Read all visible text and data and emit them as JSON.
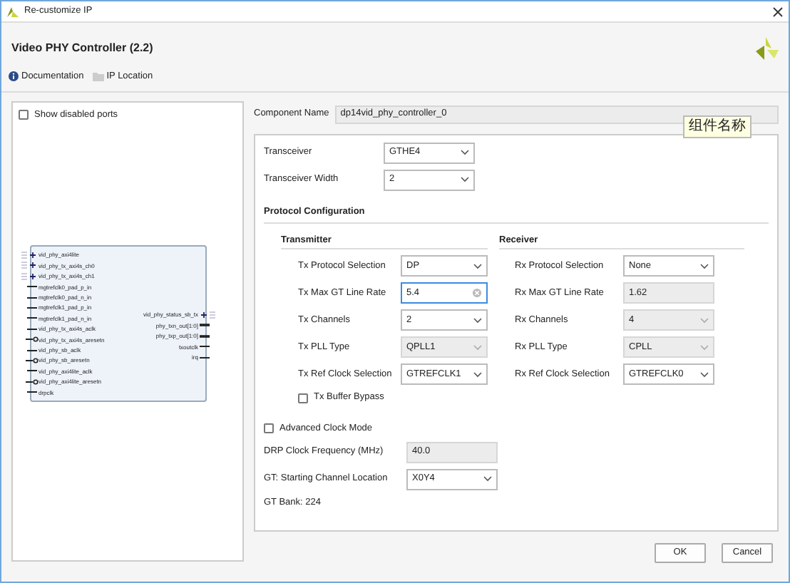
{
  "window": {
    "title": "Re-customize IP"
  },
  "header": {
    "title": "Video PHY Controller (2.2)"
  },
  "links": [
    {
      "label": "Documentation",
      "kind": "info"
    },
    {
      "label": "IP Location",
      "kind": "folder"
    }
  ],
  "show_disabled_ports": {
    "label": "Show disabled ports",
    "checked": false
  },
  "block": {
    "left_ports": [
      {
        "name": "vid_phy_axi4lite",
        "kind": "bus"
      },
      {
        "name": "vid_phy_tx_axi4s_ch0",
        "kind": "bus"
      },
      {
        "name": "vid_phy_tx_axi4s_ch1",
        "kind": "bus"
      },
      {
        "name": "mgtrefclk0_pad_p_in",
        "kind": "wire"
      },
      {
        "name": "mgtrefclk0_pad_n_in",
        "kind": "wire"
      },
      {
        "name": "mgtrefclk1_pad_p_in",
        "kind": "wire"
      },
      {
        "name": "mgtrefclk1_pad_n_in",
        "kind": "wire"
      },
      {
        "name": "vid_phy_tx_axi4s_aclk",
        "kind": "wire"
      },
      {
        "name": "vid_phy_tx_axi4s_aresetn",
        "kind": "reset"
      },
      {
        "name": "vid_phy_sb_aclk",
        "kind": "wire"
      },
      {
        "name": "vid_phy_sb_aresetn",
        "kind": "reset"
      },
      {
        "name": "vid_phy_axi4lite_aclk",
        "kind": "wire"
      },
      {
        "name": "vid_phy_axi4lite_aresetn",
        "kind": "reset"
      },
      {
        "name": "drpclk",
        "kind": "wire"
      }
    ],
    "right_ports": [
      {
        "name": "vid_phy_status_sb_tx",
        "kind": "bus"
      },
      {
        "name": "phy_txn_out[1:0]",
        "kind": "busline"
      },
      {
        "name": "phy_txp_out[1:0]",
        "kind": "busline"
      },
      {
        "name": "txoutclk",
        "kind": "wire"
      },
      {
        "name": "irq",
        "kind": "wire"
      }
    ]
  },
  "component_name": {
    "label": "Component Name",
    "value": "dp14vid_phy_controller_0"
  },
  "tooltip": "组件名称",
  "top_fields": [
    {
      "label": "Transceiver",
      "value": "GTHE4",
      "kind": "dropdown",
      "disabled": false
    },
    {
      "label": "Transceiver Width",
      "value": "2",
      "kind": "dropdown",
      "disabled": false
    }
  ],
  "protocol_title": "Protocol Configuration",
  "transmitter": {
    "title": "Transmitter",
    "fields": [
      {
        "label": "Tx Protocol Selection",
        "value": "DP",
        "kind": "dropdown",
        "disabled": false
      },
      {
        "label": "Tx Max GT Line Rate",
        "value": "5.4",
        "kind": "input",
        "disabled": false
      },
      {
        "label": "Tx Channels",
        "value": "2",
        "kind": "dropdown",
        "disabled": false
      },
      {
        "label": "Tx PLL Type",
        "value": "QPLL1",
        "kind": "dropdown",
        "disabled": true
      },
      {
        "label": "Tx Ref Clock Selection",
        "value": "GTREFCLK1",
        "kind": "dropdown",
        "disabled": false
      }
    ],
    "buffer_bypass": {
      "label": "Tx Buffer Bypass",
      "checked": false
    }
  },
  "receiver": {
    "title": "Receiver",
    "fields": [
      {
        "label": "Rx Protocol Selection",
        "value": "None",
        "kind": "dropdown",
        "disabled": false
      },
      {
        "label": "Rx Max GT Line Rate",
        "value": "1.62",
        "kind": "readonly",
        "disabled": true
      },
      {
        "label": "Rx Channels",
        "value": "4",
        "kind": "dropdown",
        "disabled": true
      },
      {
        "label": "Rx PLL Type",
        "value": "CPLL",
        "kind": "dropdown",
        "disabled": true
      },
      {
        "label": "Rx Ref Clock Selection",
        "value": "GTREFCLK0",
        "kind": "dropdown",
        "disabled": false
      }
    ]
  },
  "advanced_clock": {
    "label": "Advanced Clock Mode",
    "checked": false
  },
  "bottom_fields": [
    {
      "label": "DRP Clock Frequency (MHz)",
      "value": "40.0",
      "kind": "readonly",
      "disabled": true
    },
    {
      "label": "GT: Starting Channel Location",
      "value": "X0Y4",
      "kind": "dropdown",
      "disabled": false
    }
  ],
  "gt_bank": "GT Bank: 224",
  "buttons": [
    "OK",
    "Cancel"
  ]
}
